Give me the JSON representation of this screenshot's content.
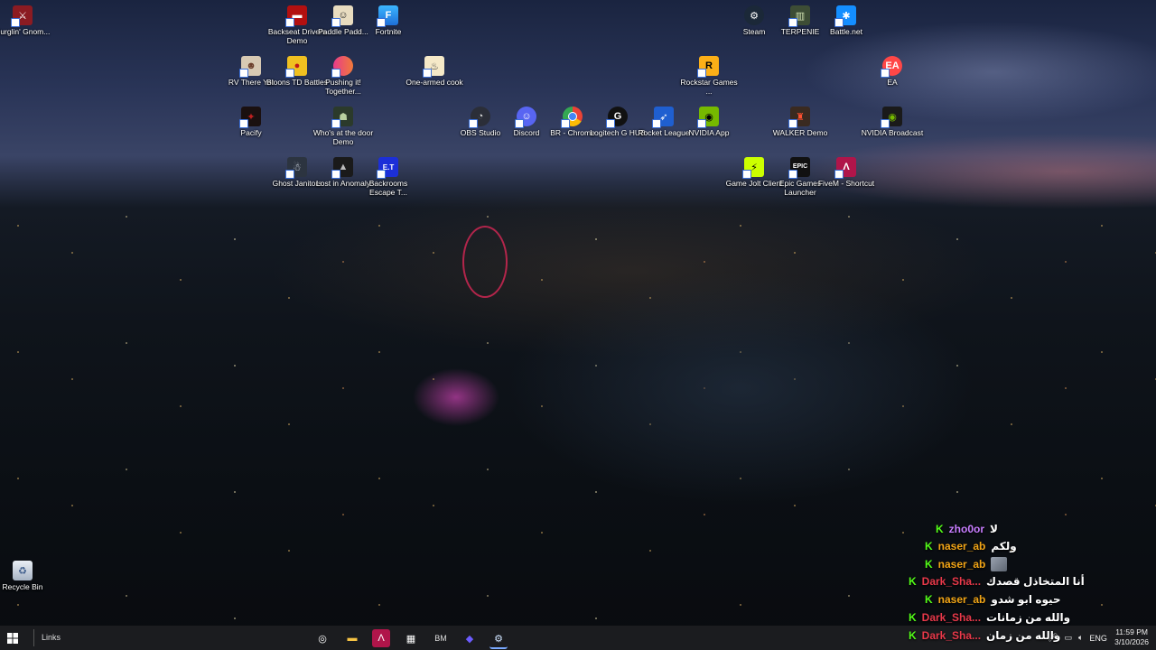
{
  "desktop": {
    "icons": {
      "burglin": "Burglin' Gnom...",
      "backseat": "Backseat Drivers Demo",
      "paddle": "Paddle Padd...",
      "fortnite": "Fortnite",
      "steam": "Steam",
      "terpenie": "TERPENIE",
      "battlenet": "Battle.net",
      "rvthereyet": "RV There Yet",
      "bloons": "Bloons TD Battles",
      "pushing": "Pushing it! Together...",
      "onearmed": "One-armed cook",
      "rockstar": "Rockstar Games ...",
      "ea": "EA",
      "pacify": "Pacify",
      "whosatdoor": "Who's at the door Demo",
      "obs": "OBS Studio",
      "discord": "Discord",
      "brchrome": "BR - Chrome",
      "logitech": "Logitech G HUB",
      "rocketleague": "Rocket League",
      "nvidiaapp": "NVIDIA App",
      "walker": "WALKER Demo",
      "nvidiabroadcast": "NVIDIA Broadcast",
      "ghostjanitors": "Ghost Janitors",
      "lostinanomaly": "Lost in Anomaly",
      "backrooms": "Backrooms Escape T...",
      "gamejolt": "Game Jolt Client",
      "epic": "Epic Games Launcher",
      "fivem": "FiveM - Shortcut",
      "recyclebin": "Recycle Bin"
    }
  },
  "chat": {
    "messages": [
      {
        "user": "zho0or",
        "text": "لا",
        "color": "#c77dff"
      },
      {
        "user": "naser_ab",
        "text": "ولكم",
        "color": "#f2a516"
      },
      {
        "user": "naser_ab",
        "text": "",
        "color": "#f2a516"
      },
      {
        "user": "Dark_Sha...",
        "text": "أنا المتخاذل قصدك",
        "color": "#e8394a"
      },
      {
        "user": "naser_ab",
        "text": "حيوه ابو شدو",
        "color": "#f2a516"
      },
      {
        "user": "Dark_Sha...",
        "text": "والله من زمانات",
        "color": "#e8394a"
      },
      {
        "user": "Dark_Sha...",
        "text": "والله من زمان",
        "color": "#e8394a"
      }
    ]
  },
  "taskbar": {
    "links_label": "Links",
    "language": "ENG",
    "time": "11:59 PM",
    "date": "3/10/2026"
  }
}
